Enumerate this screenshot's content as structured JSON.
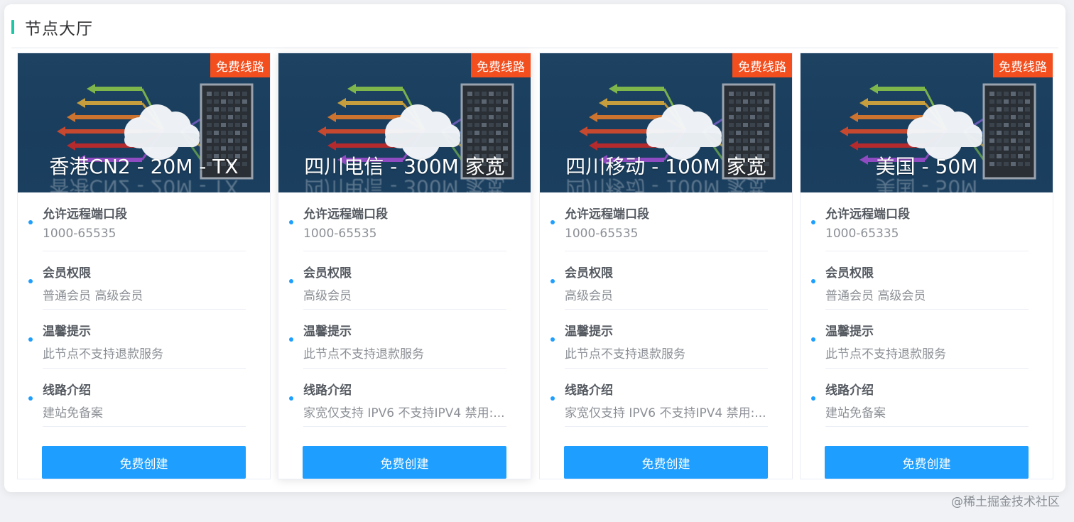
{
  "section": {
    "title": "节点大厅"
  },
  "cards": [
    {
      "tag": "免费线路",
      "title": "香港CN2 - 20M - TX",
      "items": [
        {
          "label": "允许远程端口段",
          "value": "1000-65535"
        },
        {
          "label": "会员权限",
          "value": "普通会员 高级会员"
        },
        {
          "label": "温馨提示",
          "value": "此节点不支持退款服务"
        },
        {
          "label": "线路介绍",
          "value": "建站免备案"
        }
      ],
      "button": "免费创建"
    },
    {
      "tag": "免费线路",
      "title": "四川电信 - 300M 家宽",
      "items": [
        {
          "label": "允许远程端口段",
          "value": "1000-65535"
        },
        {
          "label": "会员权限",
          "value": "高级会员"
        },
        {
          "label": "温馨提示",
          "value": "此节点不支持退款服务"
        },
        {
          "label": "线路介绍",
          "value": "家宽仅支持 IPV6 不支持IPV4 禁用:..."
        }
      ],
      "button": "免费创建"
    },
    {
      "tag": "免费线路",
      "title": "四川移动 - 100M 家宽",
      "items": [
        {
          "label": "允许远程端口段",
          "value": "1000-65535"
        },
        {
          "label": "会员权限",
          "value": "高级会员"
        },
        {
          "label": "温馨提示",
          "value": "此节点不支持退款服务"
        },
        {
          "label": "线路介绍",
          "value": "家宽仅支持 IPV6 不支持IPV4 禁用:..."
        }
      ],
      "button": "免费创建"
    },
    {
      "tag": "免费线路",
      "title": "美国 - 50M",
      "items": [
        {
          "label": "允许远程端口段",
          "value": "1000-65335"
        },
        {
          "label": "会员权限",
          "value": "普通会员 高级会员"
        },
        {
          "label": "温馨提示",
          "value": "此节点不支持退款服务"
        },
        {
          "label": "线路介绍",
          "value": "建站免备案"
        }
      ],
      "button": "免费创建"
    }
  ],
  "watermark": "@稀土掘金技术社区",
  "colors": {
    "accent": "#1e9fff",
    "tag": "#f24e1e",
    "header_bar": "#1fc6a6",
    "banner_bg": "#1d4262"
  },
  "icons": {
    "banner_art": "cloud-server-network-icon",
    "bullet": "dot-icon"
  }
}
